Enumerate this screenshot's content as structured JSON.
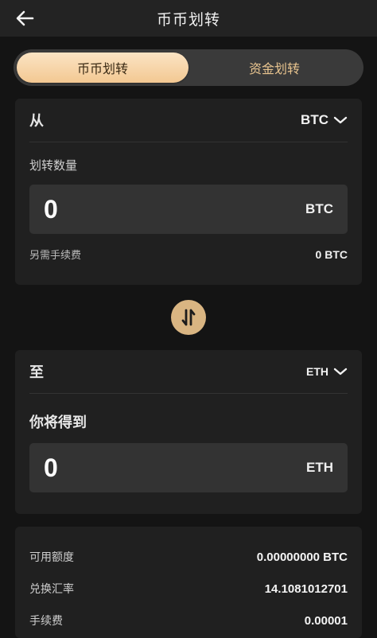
{
  "header": {
    "title": "币币划转"
  },
  "tabs": [
    {
      "label": "币币划转"
    },
    {
      "label": "资金划转"
    }
  ],
  "from": {
    "label": "从",
    "coin": "BTC",
    "amount_label": "划转数量",
    "amount_value": "0",
    "amount_unit": "BTC",
    "fee_label": "另需手续费",
    "fee_value": "0 BTC"
  },
  "to": {
    "label": "至",
    "coin": "ETH",
    "receive_label": "你将得到",
    "receive_value": "0",
    "receive_unit": "ETH"
  },
  "info": [
    {
      "label": "可用额度",
      "value": "0.00000000 BTC"
    },
    {
      "label": "兑换汇率",
      "value": "14.1081012701"
    },
    {
      "label": "手续费",
      "value": "0.00001"
    }
  ],
  "colors": {
    "accent": "#d9b582",
    "tab_active": "#f3c892",
    "background": "#141414"
  },
  "icons": {
    "back": "arrow-left-icon",
    "dropdown": "chevron-down-icon",
    "swap": "swap-vertical-icon"
  }
}
